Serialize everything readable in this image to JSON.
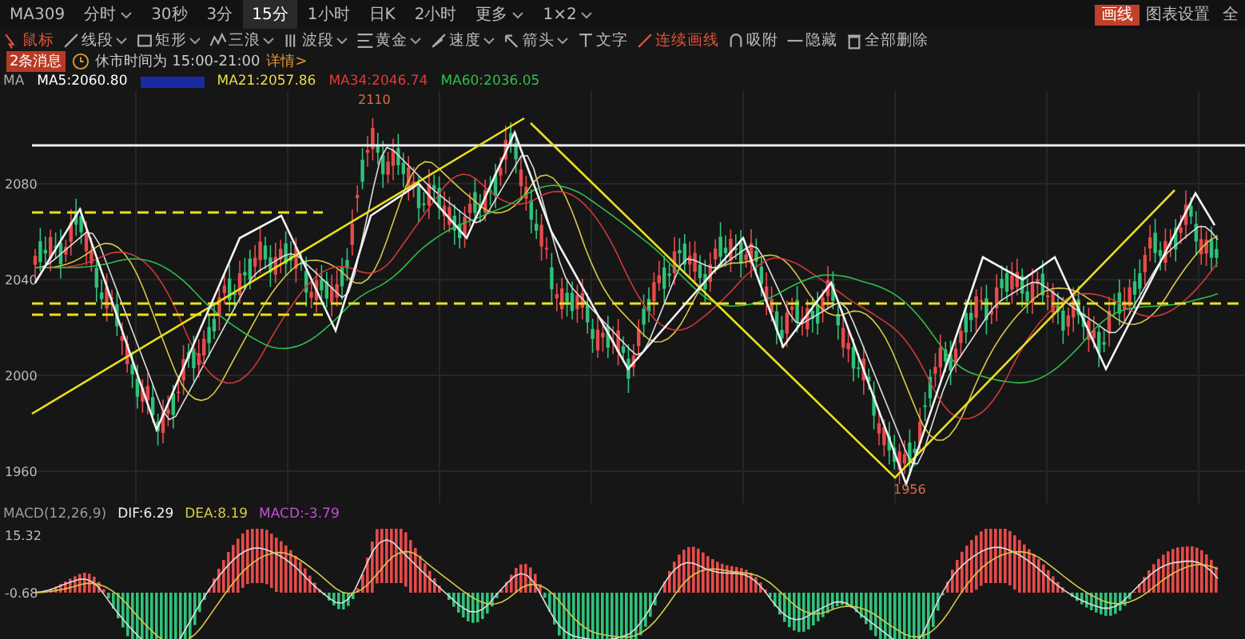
{
  "tabs": [
    {
      "label": "MA309",
      "selected": false,
      "caret": false
    },
    {
      "label": "分时",
      "selected": false,
      "caret": true
    },
    {
      "label": "30秒",
      "selected": false,
      "caret": false
    },
    {
      "label": "3分",
      "selected": false,
      "caret": false
    },
    {
      "label": "15分",
      "selected": true,
      "caret": false
    },
    {
      "label": "1小时",
      "selected": false,
      "caret": false
    },
    {
      "label": "日K",
      "selected": false,
      "caret": false
    },
    {
      "label": "2小时",
      "selected": false,
      "caret": false
    },
    {
      "label": "更多",
      "selected": false,
      "caret": true
    },
    {
      "label": "1×2",
      "selected": false,
      "caret": true
    }
  ],
  "top_right": [
    {
      "label": "画线",
      "selected": true
    },
    {
      "label": "图表设置",
      "selected": false
    },
    {
      "label": "全",
      "selected": false
    }
  ],
  "toolbar": [
    {
      "label": "鼠标",
      "selected": true,
      "caret": false
    },
    {
      "label": "线段",
      "selected": false,
      "caret": true
    },
    {
      "label": "矩形",
      "selected": false,
      "caret": true
    },
    {
      "label": "三浪",
      "selected": false,
      "caret": true
    },
    {
      "label": "波段",
      "selected": false,
      "caret": true
    },
    {
      "label": "黄金",
      "selected": false,
      "caret": true
    },
    {
      "label": "速度",
      "selected": false,
      "caret": true
    },
    {
      "label": "箭头",
      "selected": false,
      "caret": true
    },
    {
      "label": "文字",
      "selected": false,
      "caret": false
    },
    {
      "label": "连续画线",
      "selected": true,
      "caret": false
    },
    {
      "label": "吸附",
      "selected": false,
      "caret": false
    },
    {
      "label": "隐藏",
      "selected": false,
      "caret": false
    },
    {
      "label": "全部删除",
      "selected": false,
      "caret": false
    }
  ],
  "notice": {
    "badge": "2条消息",
    "text": "休市时间为 15:00-21:00",
    "link": "详情>"
  },
  "ma_legend": {
    "label": "MA",
    "items": [
      {
        "text": "MA5:2060.80",
        "color": "#ffffff"
      },
      {
        "text": "MA21:2057.86",
        "color": "#e8d84a"
      },
      {
        "text": "MA34:2046.74",
        "color": "#e03a3a"
      },
      {
        "text": "MA60:2036.05",
        "color": "#2fbf4a"
      }
    ]
  },
  "price_axis": [
    "2080",
    "2040",
    "2000",
    "1960"
  ],
  "high_label": "2110",
  "low_label": "1956",
  "macd_legend": {
    "label": "MACD(12,26,9)",
    "dif": "DIF:6.29",
    "dea": "DEA:8.19",
    "macd": "MACD:-3.79"
  },
  "macd_axis": [
    "15.32",
    "-0.68"
  ]
}
